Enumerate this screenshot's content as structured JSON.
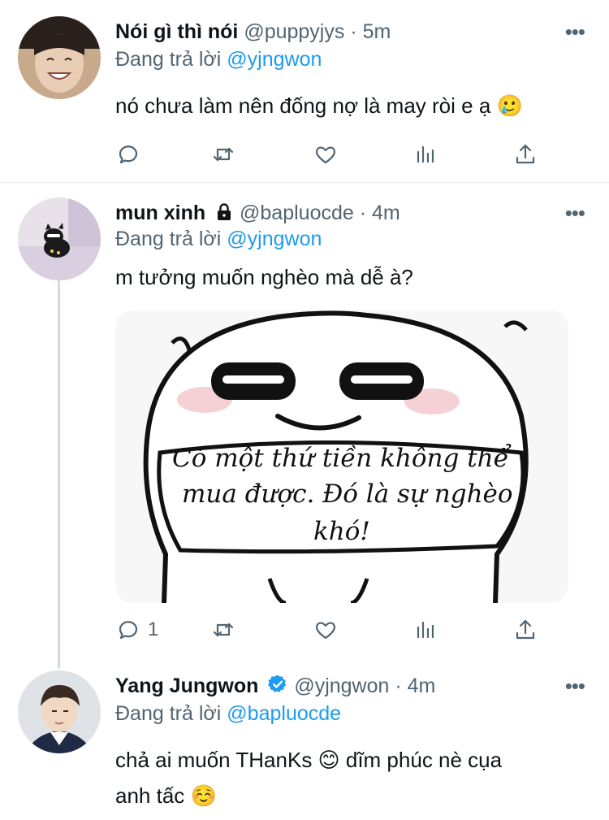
{
  "tweets": [
    {
      "display_name": "Nói gì thì nói",
      "handle": "@puppyjys",
      "time": "5m",
      "reply_prefix": "Đang trả lời",
      "reply_to": "@yjngwon",
      "text": "nó chưa làm nên đống nợ là may ròi e ạ 🥲",
      "reply_count": "",
      "avatar_icon": "person-avatar"
    },
    {
      "display_name": "mun xinh",
      "handle": "@bapluocde",
      "time": "4m",
      "reply_prefix": "Đang trả lời",
      "reply_to": "@yjngwon",
      "text": "m tưởng muốn nghèo mà dễ à?",
      "reply_count": "1",
      "meme_text": [
        "Có một thứ tiền không thể",
        "mua được. Đó là sự nghèo",
        "khó!"
      ],
      "avatar_icon": "cat-avatar"
    },
    {
      "display_name": "Yang Jungwon",
      "handle": "@yjngwon",
      "time": "4m",
      "reply_prefix": "Đang trả lời",
      "reply_to": "@bapluocde",
      "text_line1": "chả ai muốn THanKs 😊  dĩm phúc nè cụa",
      "text_line2": "anh tấc ☺️",
      "avatar_icon": "person-avatar"
    }
  ],
  "separator": "·",
  "more_label": "•••",
  "colors": {
    "accent": "#1d9bf0",
    "muted": "#536471",
    "verified": "#1d9bf0"
  }
}
